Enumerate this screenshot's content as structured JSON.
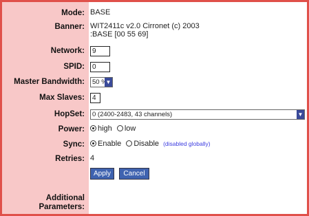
{
  "labels": {
    "mode": "Mode:",
    "banner": "Banner:",
    "network": "Network:",
    "spid": "SPID:",
    "master_bandwidth": "Master Bandwidth:",
    "max_slaves": "Max Slaves:",
    "hopset": "HopSet:",
    "power": "Power:",
    "sync": "Sync:",
    "retries": "Retries:",
    "additional_1": "Additional",
    "additional_2": "Parameters:"
  },
  "values": {
    "mode": "BASE",
    "banner_line1": "WIT2411c v2.0 Cirronet (c) 2003",
    "banner_line2": ":BASE [00 55 69]",
    "network": "9",
    "spid": "0",
    "master_bandwidth": "50 %",
    "max_slaves": "4",
    "hopset": "0 (2400-2483, 43 channels)",
    "power": {
      "options": [
        "high",
        "low"
      ],
      "selected": "high"
    },
    "sync": {
      "options": [
        "Enable",
        "Disable"
      ],
      "selected": "Enable",
      "note": "(disabled globally)"
    },
    "retries": "4"
  },
  "buttons": {
    "apply": "Apply",
    "cancel": "Cancel"
  },
  "colors": {
    "border": "#e0504a",
    "label_background": "#f8c8c8",
    "button": "#3f63b0",
    "note": "#3b3be0",
    "dropdown_arrow": "#3a4a9a"
  },
  "icons": {
    "dropdown": "chevron-down-icon",
    "radio": "radio-icon"
  }
}
